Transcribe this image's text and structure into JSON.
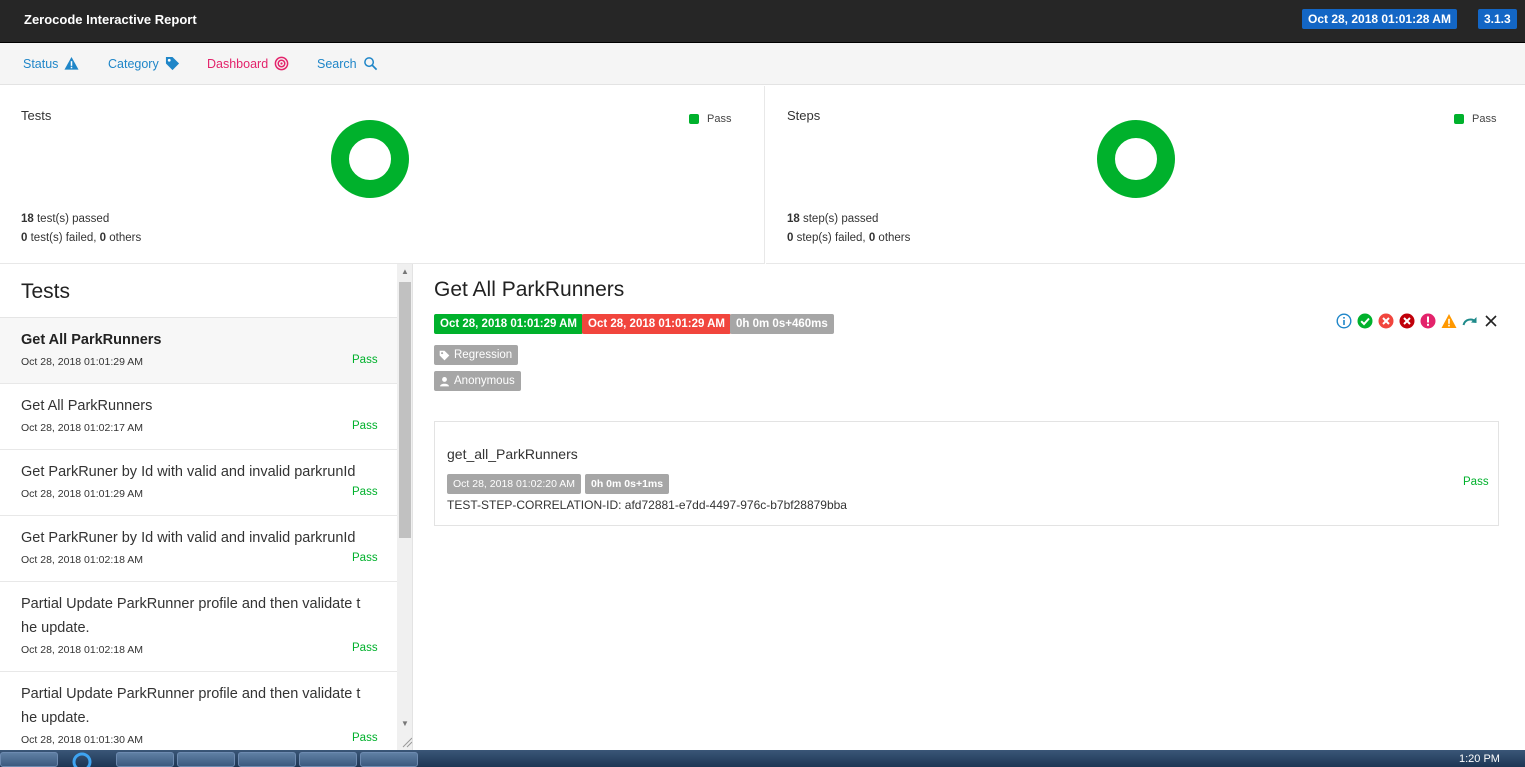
{
  "header": {
    "title": "Zerocode Interactive Report",
    "date": "Oct 28, 2018 01:01:28 AM",
    "version": "3.1.3"
  },
  "nav": {
    "status": "Status",
    "category": "Category",
    "dashboard": "Dashboard",
    "search": "Search"
  },
  "summary": {
    "tests": {
      "title": "Tests",
      "legend": "Pass",
      "passed_count": "18",
      "passed_text": " test(s) passed",
      "failed_count": "0",
      "failed_text": " test(s) failed, ",
      "others_count": "0",
      "others_text": " others"
    },
    "steps": {
      "title": "Steps",
      "legend": "Pass",
      "passed_count": "18",
      "passed_text": " step(s) passed",
      "failed_count": "0",
      "failed_text": " step(s) failed, ",
      "others_count": "0",
      "others_text": " others"
    },
    "pass_color": "#00b12c"
  },
  "test_list": {
    "title": "Tests",
    "items": [
      {
        "name": "Get All ParkRunners",
        "time": "Oct 28, 2018 01:01:29 AM",
        "status": "Pass"
      },
      {
        "name": "Get All ParkRunners",
        "time": "Oct 28, 2018 01:02:17 AM",
        "status": "Pass"
      },
      {
        "name": "Get ParkRuner by Id with valid and invalid parkrunId",
        "time": "Oct 28, 2018 01:01:29 AM",
        "status": "Pass"
      },
      {
        "name": "Get ParkRuner by Id with valid and invalid parkrunId",
        "time": "Oct 28, 2018 01:02:18 AM",
        "status": "Pass"
      },
      {
        "name": "Partial Update ParkRunner profile and then validate t",
        "name2": "he update.",
        "time": "Oct 28, 2018 01:02:18 AM",
        "status": "Pass"
      },
      {
        "name": "Partial Update ParkRunner profile and then validate t",
        "name2": "he update.",
        "time": "Oct 28, 2018 01:01:30 AM",
        "status": "Pass"
      }
    ]
  },
  "detail": {
    "title": "Get All ParkRunners",
    "start_time": "Oct 28, 2018 01:01:29 AM",
    "end_time": "Oct 28, 2018 01:01:29 AM",
    "duration": "0h 0m 0s+460ms",
    "category": "Regression",
    "author": "Anonymous",
    "step": {
      "name": "get_all_ParkRunners",
      "time": "Oct 28, 2018 01:02:20 AM",
      "duration": "0h 0m 0s+1ms",
      "correlation": "TEST-STEP-CORRELATION-ID: afd72881-e7dd-4497-976c-b7bf28879bba",
      "status": "Pass"
    }
  },
  "taskbar": {
    "clock": "1:20 PM"
  }
}
